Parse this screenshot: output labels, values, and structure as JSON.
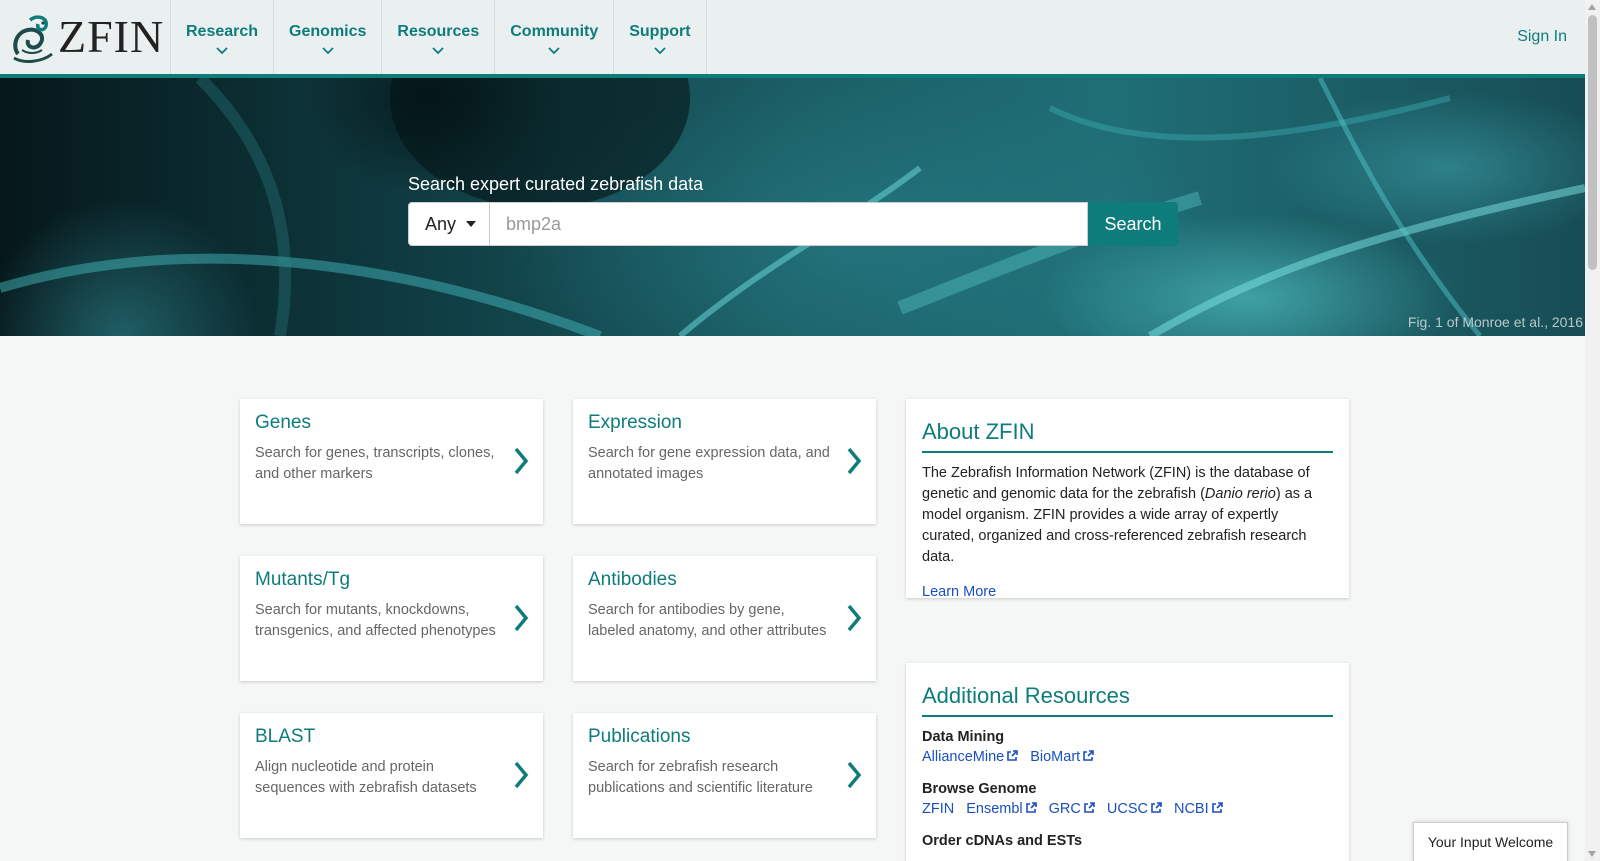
{
  "header": {
    "logo_text": "ZFIN",
    "nav": [
      {
        "label": "Research"
      },
      {
        "label": "Genomics"
      },
      {
        "label": "Resources"
      },
      {
        "label": "Community"
      },
      {
        "label": "Support"
      }
    ],
    "sign_in": "Sign In"
  },
  "hero": {
    "title": "Search expert curated zebrafish data",
    "select_value": "Any",
    "placeholder": "bmp2a",
    "search_button": "Search",
    "credit": "Fig. 1 of Monroe et al., 2016"
  },
  "cards": [
    {
      "title": "Genes",
      "desc": "Search for genes, transcripts, clones, and other markers"
    },
    {
      "title": "Expression",
      "desc": "Search for gene expression data, and annotated images"
    },
    {
      "title": "Mutants/Tg",
      "desc": "Search for mutants, knockdowns, transgenics, and affected phenotypes"
    },
    {
      "title": "Antibodies",
      "desc": "Search for antibodies by gene, labeled anatomy, and other attributes"
    },
    {
      "title": "BLAST",
      "desc": "Align nucleotide and protein sequences with zebrafish datasets"
    },
    {
      "title": "Publications",
      "desc": "Search for zebrafish research publications and scientific literature"
    }
  ],
  "about": {
    "title": "About ZFIN",
    "body_1": "The Zebrafish Information Network (ZFIN) is the database of genetic and genomic data for the zebrafish (",
    "species": "Danio rerio",
    "body_2": ") as a model organism. ZFIN provides a wide array of expertly curated, organized and cross-referenced zebrafish research data.",
    "learn_more": "Learn More"
  },
  "resources": {
    "title": "Additional Resources",
    "groups": [
      {
        "heading": "Data Mining",
        "links": [
          "AllianceMine",
          "BioMart"
        ]
      },
      {
        "heading": "Browse Genome",
        "links": [
          "ZFIN",
          "Ensembl",
          "GRC",
          "UCSC",
          "NCBI"
        ]
      },
      {
        "heading": "Order cDNAs and ESTs",
        "links": []
      }
    ]
  },
  "feedback": "Your Input Welcome",
  "colors": {
    "accent": "#0e7c7b",
    "link": "#1a4fc0",
    "header_bg": "#eaf0f0"
  }
}
